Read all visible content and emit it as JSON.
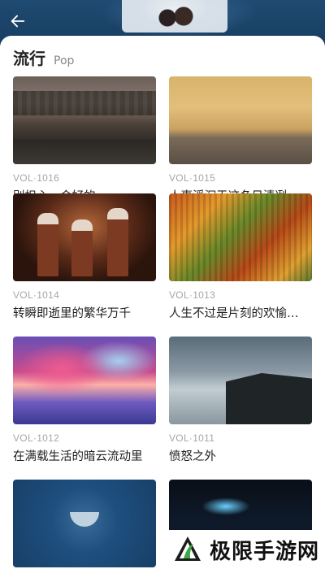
{
  "nav": {
    "back_icon": "back-arrow-icon"
  },
  "header": {
    "title": "流行",
    "subtitle": "Pop"
  },
  "items": [
    {
      "vol": "VOL·1016",
      "title": "别担心，会好的。"
    },
    {
      "vol": "VOL·1015",
      "title": "人事浮沉于这冬日清冽…"
    },
    {
      "vol": "VOL·1014",
      "title": "转瞬即逝里的繁华万千"
    },
    {
      "vol": "VOL·1013",
      "title": "人生不过是片刻的欢愉…"
    },
    {
      "vol": "VOL·1012",
      "title": "在满载生活的暗云流动里"
    },
    {
      "vol": "VOL·1011",
      "title": "愤怒之外"
    }
  ],
  "watermark": {
    "text": "极限手游网"
  },
  "colors": {
    "sheet": "#ffffff",
    "vol_text": "#a6a6a6",
    "title_text": "#1e1e1e"
  }
}
